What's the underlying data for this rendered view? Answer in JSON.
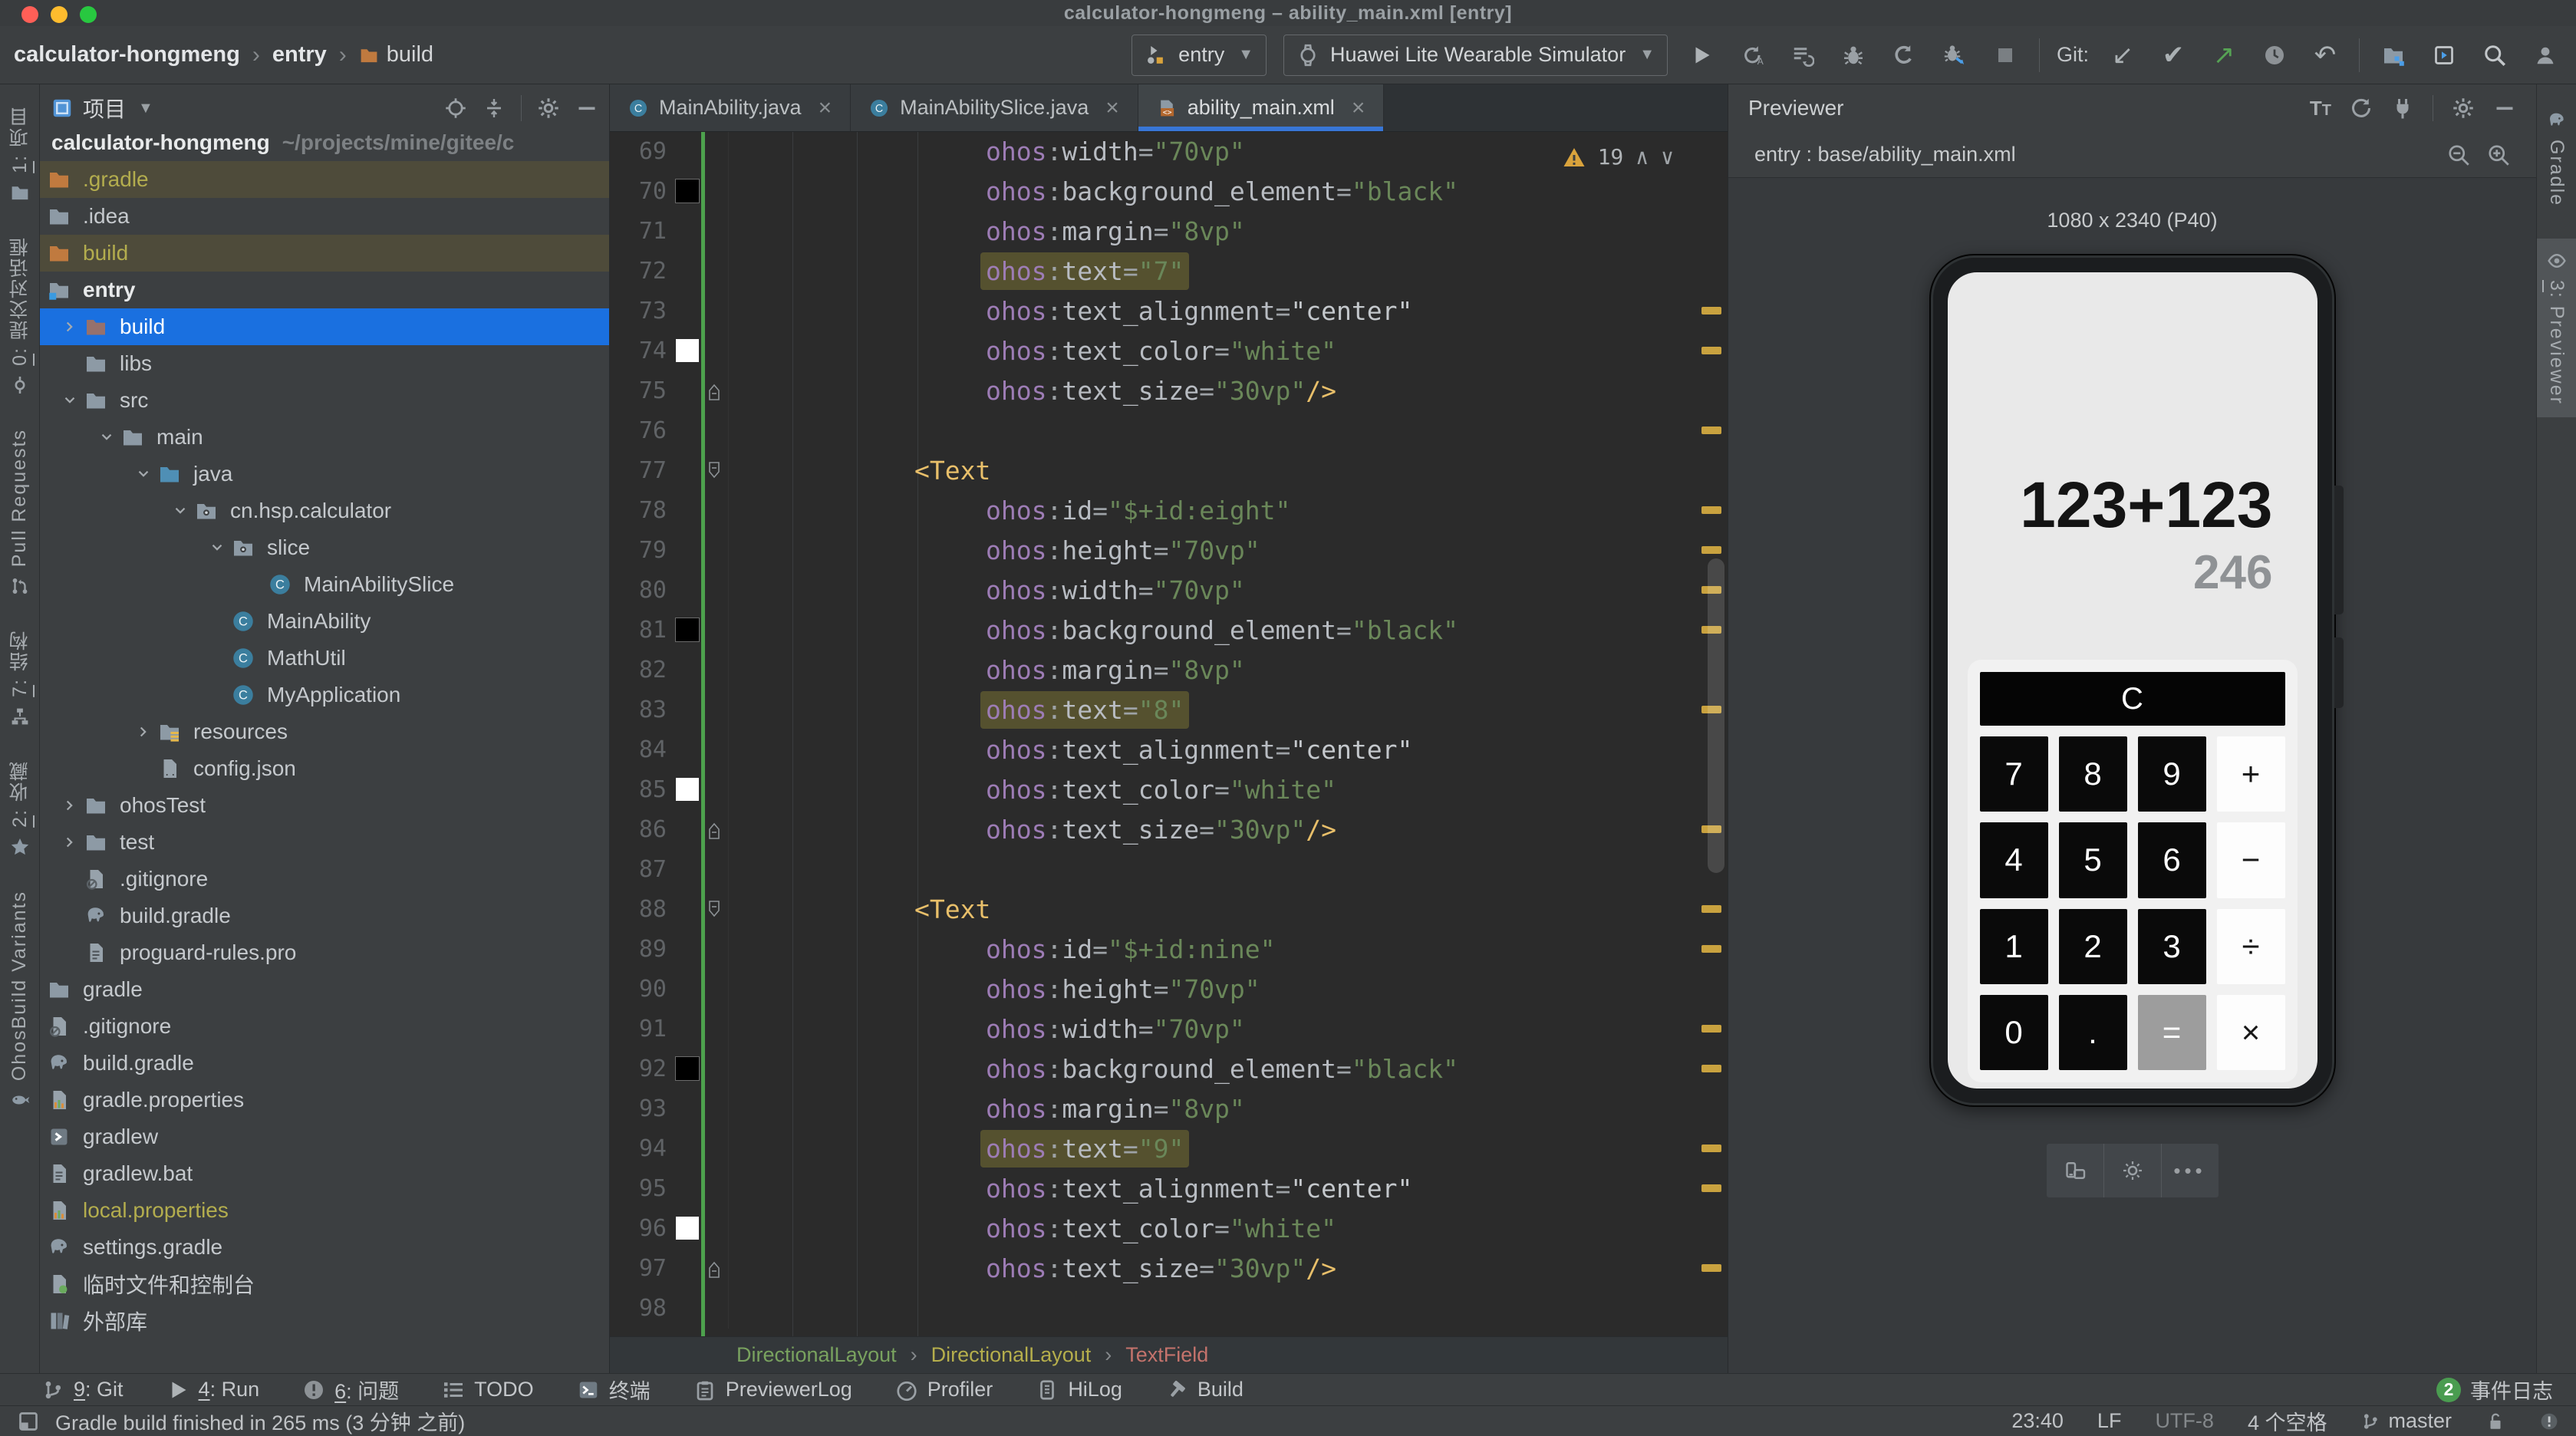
{
  "titlebar": {
    "title": "calculator-hongmeng – ability_main.xml [entry]"
  },
  "toolbar": {
    "breadcrumb": [
      {
        "label": "calculator-hongmeng",
        "bold": true
      },
      {
        "label": "entry",
        "bold": true
      },
      {
        "label": "build",
        "icon": "folder-orange"
      }
    ],
    "run_config": {
      "label": "entry"
    },
    "device": {
      "label": "Huawei Lite Wearable Simulator"
    },
    "git_label": "Git:"
  },
  "left_strip": {
    "tabs": [
      {
        "label": "1: 项目",
        "icon": "folder"
      },
      {
        "label": "0: 提交对话框",
        "icon": "commit"
      },
      {
        "label": "Pull Requests",
        "icon": "pull-request"
      },
      {
        "label": "7: 结构",
        "icon": "structure"
      },
      {
        "label": "2: 收藏",
        "icon": "star"
      },
      {
        "label": "OhosBuild Variants",
        "icon": "variants"
      }
    ]
  },
  "project": {
    "title": "项目",
    "tree": [
      {
        "label": "calculator-hongmeng",
        "path": "~/projects/mine/gitee/c",
        "depth": 0,
        "bold": true
      },
      {
        "label": ".gradle",
        "depth": 1,
        "icon": "folder-orange",
        "bg": "olive",
        "color": "olive"
      },
      {
        "label": ".idea",
        "depth": 1,
        "icon": "folder"
      },
      {
        "label": "build",
        "depth": 1,
        "icon": "folder-orange",
        "bg": "olive",
        "color": "olive"
      },
      {
        "label": "entry",
        "depth": 1,
        "icon": "folder-module",
        "bold": true
      },
      {
        "label": "build",
        "depth": 2,
        "icon": "folder-rose",
        "chevron": "right",
        "bg": "selected"
      },
      {
        "label": "libs",
        "depth": 2,
        "icon": "folder"
      },
      {
        "label": "src",
        "depth": 2,
        "icon": "folder",
        "chevron": "down"
      },
      {
        "label": "main",
        "depth": 3,
        "icon": "folder",
        "chevron": "down"
      },
      {
        "label": "java",
        "depth": 4,
        "icon": "folder-blue",
        "chevron": "down"
      },
      {
        "label": "cn.hsp.calculator",
        "depth": 5,
        "icon": "folder-pkg",
        "chevron": "down"
      },
      {
        "label": "slice",
        "depth": 6,
        "icon": "folder-pkg",
        "chevron": "down"
      },
      {
        "label": "MainAbilitySlice",
        "depth": 7,
        "icon": "class"
      },
      {
        "label": "MainAbility",
        "depth": 6,
        "icon": "class"
      },
      {
        "label": "MathUtil",
        "depth": 6,
        "icon": "class"
      },
      {
        "label": "MyApplication",
        "depth": 6,
        "icon": "class"
      },
      {
        "label": "resources",
        "depth": 4,
        "icon": "folder-res",
        "chevron": "right"
      },
      {
        "label": "config.json",
        "depth": 4,
        "icon": "json"
      },
      {
        "label": "ohosTest",
        "depth": 2,
        "icon": "folder",
        "chevron": "right"
      },
      {
        "label": "test",
        "depth": 2,
        "icon": "folder",
        "chevron": "right"
      },
      {
        "label": ".gitignore",
        "depth": 2,
        "icon": "file-ignore"
      },
      {
        "label": "build.gradle",
        "depth": 2,
        "icon": "gradle"
      },
      {
        "label": "proguard-rules.pro",
        "depth": 2,
        "icon": "file-text"
      },
      {
        "label": "gradle",
        "depth": 1,
        "icon": "folder"
      },
      {
        "label": ".gitignore",
        "depth": 1,
        "icon": "file-ignore"
      },
      {
        "label": "build.gradle",
        "depth": 1,
        "icon": "gradle"
      },
      {
        "label": "gradle.properties",
        "depth": 1,
        "icon": "file-prop"
      },
      {
        "label": "gradlew",
        "depth": 1,
        "icon": "file-sh"
      },
      {
        "label": "gradlew.bat",
        "depth": 1,
        "icon": "file-text"
      },
      {
        "label": "local.properties",
        "depth": 1,
        "icon": "file-prop",
        "color": "olive"
      },
      {
        "label": "settings.gradle",
        "depth": 1,
        "icon": "gradle"
      },
      {
        "label": "临时文件和控制台",
        "depth": 1,
        "icon": "scratch"
      },
      {
        "label": "外部库",
        "depth": 1,
        "icon": "lib"
      }
    ]
  },
  "editor": {
    "tabs": [
      {
        "label": "MainAbility.java",
        "icon": "class",
        "active": false
      },
      {
        "label": "MainAbilitySlice.java",
        "icon": "class",
        "active": false
      },
      {
        "label": "ability_main.xml",
        "icon": "xml",
        "active": true
      }
    ],
    "warning": {
      "count": "19"
    },
    "lines": [
      {
        "no": 69,
        "type": "attr",
        "name": "width",
        "value": "70vp"
      },
      {
        "no": 70,
        "type": "attr",
        "name": "background_element",
        "value": "black",
        "swatch": "black"
      },
      {
        "no": 71,
        "type": "attr",
        "name": "margin",
        "value": "8vp"
      },
      {
        "no": 72,
        "type": "attr",
        "name": "text",
        "value": "7",
        "hl": true
      },
      {
        "no": 73,
        "type": "attr",
        "name": "text_alignment",
        "value": "center",
        "plain": true
      },
      {
        "no": 74,
        "type": "attr",
        "name": "text_color",
        "value": "white",
        "swatch": "white"
      },
      {
        "no": 75,
        "type": "attr",
        "name": "text_size",
        "value": "30vp",
        "close": true,
        "fold": "up"
      },
      {
        "no": 76,
        "type": "blank"
      },
      {
        "no": 77,
        "type": "tag",
        "tag": "Text",
        "fold": "down"
      },
      {
        "no": 78,
        "type": "attr",
        "name": "id",
        "value": "$+id:eight"
      },
      {
        "no": 79,
        "type": "attr",
        "name": "height",
        "value": "70vp"
      },
      {
        "no": 80,
        "type": "attr",
        "name": "width",
        "value": "70vp"
      },
      {
        "no": 81,
        "type": "attr",
        "name": "background_element",
        "value": "black",
        "swatch": "black"
      },
      {
        "no": 82,
        "type": "attr",
        "name": "margin",
        "value": "8vp"
      },
      {
        "no": 83,
        "type": "attr",
        "name": "text",
        "value": "8",
        "hl": true
      },
      {
        "no": 84,
        "type": "attr",
        "name": "text_alignment",
        "value": "center",
        "plain": true
      },
      {
        "no": 85,
        "type": "attr",
        "name": "text_color",
        "value": "white",
        "swatch": "white"
      },
      {
        "no": 86,
        "type": "attr",
        "name": "text_size",
        "value": "30vp",
        "close": true,
        "fold": "up"
      },
      {
        "no": 87,
        "type": "blank"
      },
      {
        "no": 88,
        "type": "tag",
        "tag": "Text",
        "fold": "down"
      },
      {
        "no": 89,
        "type": "attr",
        "name": "id",
        "value": "$+id:nine"
      },
      {
        "no": 90,
        "type": "attr",
        "name": "height",
        "value": "70vp"
      },
      {
        "no": 91,
        "type": "attr",
        "name": "width",
        "value": "70vp"
      },
      {
        "no": 92,
        "type": "attr",
        "name": "background_element",
        "value": "black",
        "swatch": "black"
      },
      {
        "no": 93,
        "type": "attr",
        "name": "margin",
        "value": "8vp"
      },
      {
        "no": 94,
        "type": "attr",
        "name": "text",
        "value": "9",
        "hl": true
      },
      {
        "no": 95,
        "type": "attr",
        "name": "text_alignment",
        "value": "center",
        "plain": true
      },
      {
        "no": 96,
        "type": "attr",
        "name": "text_color",
        "value": "white",
        "swatch": "white"
      },
      {
        "no": 97,
        "type": "attr",
        "name": "text_size",
        "value": "30vp",
        "close": true,
        "fold": "up"
      },
      {
        "no": 98,
        "type": "blank"
      }
    ],
    "stripe_marks": [
      73,
      74,
      76,
      78,
      79,
      80,
      81,
      83,
      86,
      88,
      89,
      91,
      92,
      94,
      95,
      97
    ],
    "breadcrumbs": [
      {
        "label": "DirectionalLayout",
        "color": "#79a25f"
      },
      {
        "label": "DirectionalLayout",
        "color": "#b5ae4c"
      },
      {
        "label": "TextField",
        "color": "#c4736c"
      }
    ]
  },
  "previewer": {
    "title": "Previewer",
    "file": "entry : base/ability_main.xml",
    "device_label": "1080 x 2340 (P40)",
    "calculator": {
      "expression": "123+123",
      "result": "246",
      "clear_key": "C",
      "keys": [
        [
          "7",
          "8",
          "9",
          "+"
        ],
        [
          "4",
          "5",
          "6",
          "−"
        ],
        [
          "1",
          "2",
          "3",
          "÷"
        ],
        [
          "0",
          ".",
          "=",
          "×"
        ]
      ]
    }
  },
  "right_strip": {
    "tabs": [
      {
        "label": "Gradle",
        "icon": "gradle",
        "active": false
      },
      {
        "label": "3: Previewer",
        "icon": "eye",
        "active": true
      }
    ]
  },
  "bottom_bar": {
    "items": [
      {
        "label": "9: Git",
        "icon": "git"
      },
      {
        "label": "4: Run",
        "icon": "play"
      },
      {
        "label": "6: 问题",
        "icon": "error"
      },
      {
        "label": "TODO",
        "icon": "todo"
      },
      {
        "label": "终端",
        "icon": "terminal"
      },
      {
        "label": "PreviewerLog",
        "icon": "log"
      },
      {
        "label": "Profiler",
        "icon": "profiler"
      },
      {
        "label": "HiLog",
        "icon": "hilog"
      },
      {
        "label": "Build",
        "icon": "hammer"
      }
    ],
    "event_log": {
      "count": "2",
      "label": "事件日志"
    }
  },
  "statusbar": {
    "message": "Gradle build finished in 265 ms (3 分钟 之前)",
    "time": "23:40",
    "line_sep": "LF",
    "encoding": "UTF-8",
    "indent": "4 个空格",
    "branch": "master"
  }
}
